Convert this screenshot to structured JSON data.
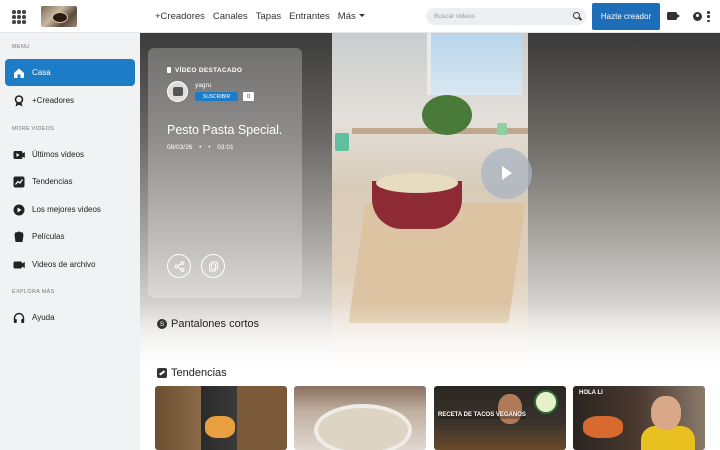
{
  "header": {
    "nav": [
      "+Creadores",
      "Canales",
      "Tapas",
      "Entrantes",
      "Más"
    ],
    "search_placeholder": "Buscar videos",
    "creator_button": "Hazte creador"
  },
  "sidebar": {
    "section_menu": "MENU",
    "section_more_videos": "MORE VIDEOS",
    "section_explore": "EXPLORA MÁS",
    "items": [
      {
        "label": "Casa",
        "icon": "home-icon",
        "active": true
      },
      {
        "label": "+Creadores",
        "icon": "creators-icon"
      },
      {
        "label": "Últimos videos",
        "icon": "latest-videos-icon"
      },
      {
        "label": "Tendencias",
        "icon": "trending-icon"
      },
      {
        "label": "Los mejores videos",
        "icon": "best-videos-icon"
      },
      {
        "label": "Películas",
        "icon": "movies-icon"
      },
      {
        "label": "Videos de archivo",
        "icon": "archive-videos-icon"
      },
      {
        "label": "Ayuda",
        "icon": "help-icon"
      }
    ]
  },
  "featured": {
    "label": "VÍDEO DESTACADO",
    "username": "yagru",
    "subscribe_label": "SUSCRIBIR",
    "subscriber_count": "0",
    "title": "Pesto Pasta Special.",
    "date": "08/03/26",
    "separator": "•",
    "separator2": "•",
    "duration": "03:01"
  },
  "sections": {
    "shorts_title": "Pantalones cortos",
    "shorts_icon_letter": "S",
    "trending_title": "Tendencias"
  },
  "thumbnails": [
    {
      "text": ""
    },
    {
      "text": ""
    },
    {
      "text": "RECETA DE TACOS VEGANOS"
    },
    {
      "text": "HOLA LI"
    }
  ],
  "colors": {
    "accent": "#1d7cc6",
    "button": "#1d6db8"
  }
}
